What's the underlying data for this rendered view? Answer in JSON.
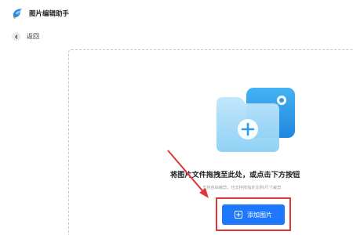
{
  "app": {
    "title": "图片编辑助手",
    "logo_icon": "bird-logo-icon"
  },
  "nav": {
    "back_label": "返回",
    "back_icon": "chevron-left-icon"
  },
  "dropzone": {
    "illustration_icon": "folder-add-icon",
    "hint_main": "将图片文件拖拽至此处，或点击下方按钮",
    "hint_sub": "支持自由裁剪，也支持按指定比例/尺寸裁剪"
  },
  "add_button": {
    "label": "添加图片",
    "icon": "plus-square-icon"
  },
  "colors": {
    "accent": "#1e78ff",
    "highlight": "#e0353b",
    "folder_back": "#2f9be9",
    "folder_front": "#8fd0f5"
  }
}
